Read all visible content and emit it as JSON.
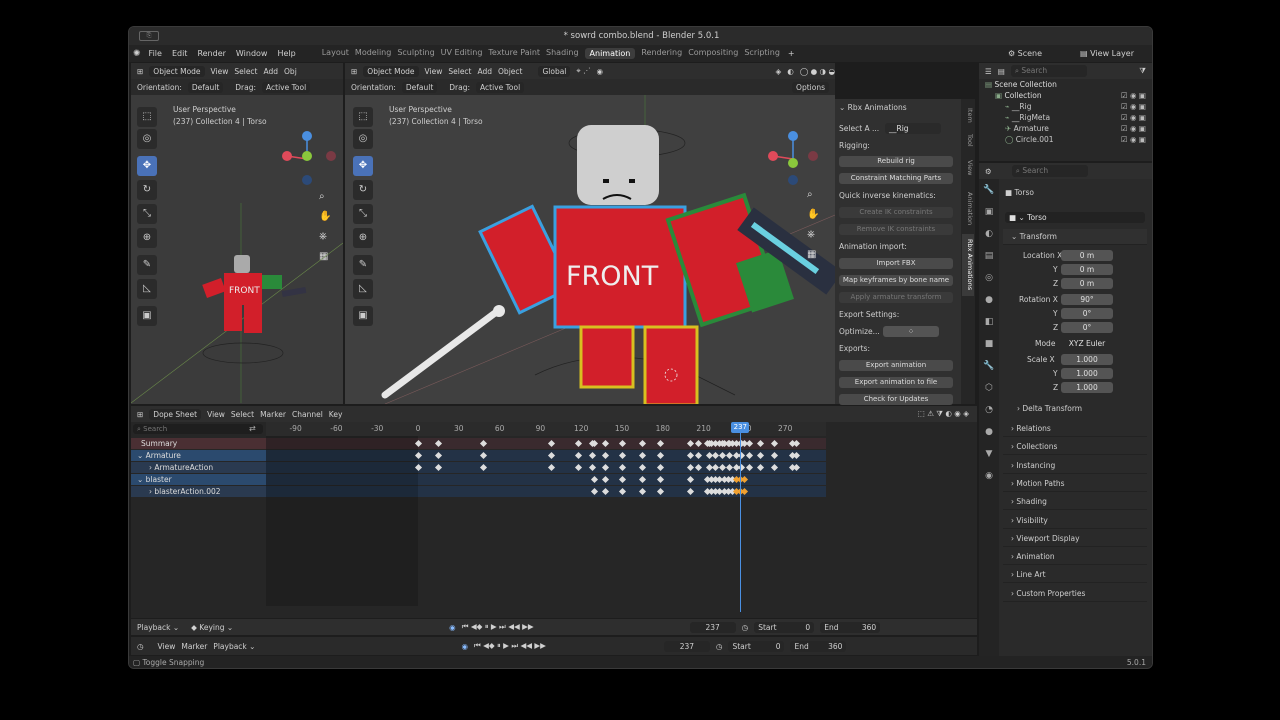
{
  "window": {
    "title": "* sowrd combo.blend - Blender 5.0.1"
  },
  "menu": [
    "File",
    "Edit",
    "Render",
    "Window",
    "Help"
  ],
  "workspaces": [
    "Layout",
    "Modeling",
    "Sculpting",
    "UV Editing",
    "Texture Paint",
    "Shading",
    "Animation",
    "Rendering",
    "Compositing",
    "Scripting"
  ],
  "active_workspace": "Animation",
  "scene": "Scene",
  "view_layer": "View Layer",
  "vp_left": {
    "mode": "Object Mode",
    "menus": [
      "View",
      "Select",
      "Add",
      "Obj"
    ],
    "orientation_label": "Orientation:",
    "orientation": "Default",
    "drag_label": "Drag:",
    "drag": "Active Tool",
    "persp": "User Perspective",
    "info": "(237) Collection 4 | Torso"
  },
  "vp_main": {
    "mode": "Object Mode",
    "menus": [
      "View",
      "Select",
      "Add",
      "Object"
    ],
    "transform": "Global",
    "orientation_label": "Orientation:",
    "orientation": "Default",
    "drag_label": "Drag:",
    "drag": "Active Tool",
    "options": "Options",
    "persp": "User Perspective",
    "info": "(237) Collection 4 | Torso",
    "front_text": "FRONT"
  },
  "rbx": {
    "title": "Rbx Animations",
    "select_label": "Select A ...",
    "select_value": "__Rig",
    "rigging": "Rigging:",
    "rebuild": "Rebuild rig",
    "constraint": "Constraint Matching Parts",
    "qik": "Quick inverse kinematics:",
    "create_ik": "Create IK constraints",
    "remove_ik": "Remove IK constraints",
    "anim_import": "Animation import:",
    "import_fbx": "Import FBX",
    "map_kf": "Map keyframes by bone name",
    "apply_arm": "Apply armature transform",
    "export_settings": "Export Settings:",
    "optimize": "Optimize...",
    "exports": "Exports:",
    "export_anim": "Export animation",
    "export_file": "Export animation to file",
    "check_updates": "Check for Updates"
  },
  "side_tabs": [
    "Item",
    "Tool",
    "View",
    "Animation",
    "Rbx Animations"
  ],
  "outliner": {
    "search": "Search",
    "items": [
      {
        "name": "Scene Collection",
        "indent": 0
      },
      {
        "name": "Collection",
        "indent": 1
      },
      {
        "name": "__Rig",
        "indent": 2
      },
      {
        "name": "__RigMeta",
        "indent": 2
      },
      {
        "name": "Armature",
        "indent": 2
      },
      {
        "name": "Circle.001",
        "indent": 2
      }
    ]
  },
  "props": {
    "search": "Search",
    "object": "Torso",
    "data": "Torso",
    "transform": "Transform",
    "loc_label": "Location X",
    "loc": [
      "0 m",
      "0 m",
      "0 m"
    ],
    "rot_label": "Rotation X",
    "rot": [
      "90°",
      "0°",
      "0°"
    ],
    "mode_label": "Mode",
    "mode": "XYZ Euler",
    "scale_label": "Scale X",
    "scale": [
      "1.000",
      "1.000",
      "1.000"
    ],
    "axes": [
      "Y",
      "Z"
    ],
    "delta": "Delta Transform",
    "sections": [
      "Relations",
      "Collections",
      "Instancing",
      "Motion Paths",
      "Shading",
      "Visibility",
      "Viewport Display",
      "Animation",
      "Line Art",
      "Custom Properties"
    ]
  },
  "dope": {
    "editor": "Dope Sheet",
    "menus": [
      "View",
      "Select",
      "Marker",
      "Channel",
      "Key"
    ],
    "search": "Search",
    "ticks": [
      -90,
      -60,
      -30,
      0,
      30,
      60,
      90,
      120,
      150,
      180,
      210,
      240,
      270
    ],
    "current_frame": 237,
    "channels": [
      {
        "name": "Summary",
        "type": "summary"
      },
      {
        "name": "Armature",
        "type": "object"
      },
      {
        "name": "ArmatureAction",
        "type": "action"
      },
      {
        "name": "blaster",
        "type": "object"
      },
      {
        "name": "blasterAction.002",
        "type": "action"
      }
    ],
    "keys_armature": [
      0,
      15,
      48,
      98,
      118,
      128,
      138,
      150,
      165,
      178,
      200,
      206,
      214,
      219,
      224,
      229,
      234,
      238,
      244,
      252,
      262,
      275,
      278
    ],
    "keys_blaster": [
      130,
      138,
      150,
      165,
      178,
      200,
      213,
      216,
      219,
      222,
      225,
      228,
      231,
      234,
      237,
      240
    ]
  },
  "playback": {
    "playback": "Playback",
    "keying": "Keying",
    "frame": "237",
    "start_label": "Start",
    "start": "0",
    "end_label": "End",
    "end": "360"
  },
  "timeline": {
    "menus": [
      "View",
      "Marker",
      "Playback"
    ],
    "frame": "237",
    "start_label": "Start",
    "start": "0",
    "end_label": "End",
    "end": "360"
  },
  "status": {
    "left": "Toggle Snapping",
    "version": "5.0.1"
  }
}
